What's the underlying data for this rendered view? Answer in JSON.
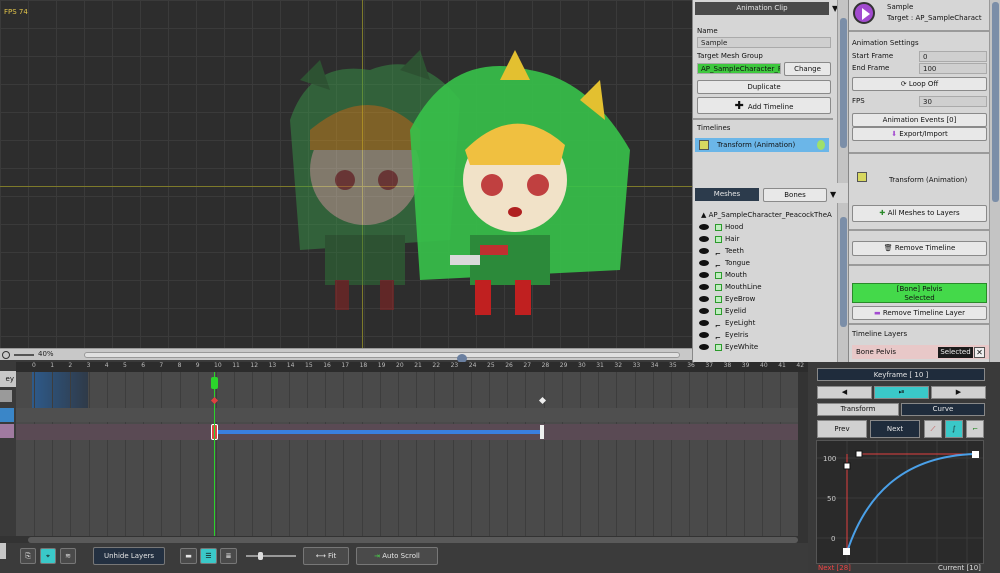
{
  "viewport": {
    "fps_label": "FPS 74",
    "zoom_label": "40%"
  },
  "anim_clip": {
    "header": "Animation Clip",
    "name_label": "Name",
    "name_value": "Sample",
    "target_mesh_group_label": "Target Mesh Group",
    "target_mesh_group_value": "AP_SampleCharacter_F",
    "change_button": "Change",
    "duplicate_button": "Duplicate",
    "add_timeline_button": "Add Timeline",
    "timelines_label": "Timelines",
    "timeline_item": "Transform (Animation)"
  },
  "mesh_list": {
    "tab_meshes": "Meshes",
    "tab_bones": "Bones",
    "root_label": "AP_SampleCharacter_PeacockTheA",
    "items": [
      "Hood",
      "Hair",
      "Teeth",
      "Tongue",
      "Mouth",
      "MouthLine",
      "EyeBrow",
      "Eyelid",
      "EyeLight",
      "EyeIris",
      "EyeWhite"
    ],
    "item_types": [
      "mesh",
      "mesh",
      "bone",
      "bone",
      "mesh",
      "mesh",
      "mesh",
      "mesh",
      "bone",
      "bone",
      "mesh"
    ]
  },
  "clip_info": {
    "title": "Sample",
    "target": "Target : AP_SampleCharact",
    "settings_label": "Animation Settings",
    "start_frame_label": "Start Frame",
    "start_frame_value": "0",
    "end_frame_label": "End Frame",
    "end_frame_value": "100",
    "loop_button": "Loop Off",
    "fps_label": "FPS",
    "fps_value": "30",
    "events_button": "Animation Events [0]",
    "export_button": "Export/Import",
    "timeline_name": "Transform (Animation)",
    "all_meshes_button": "All Meshes to Layers",
    "remove_timeline_button": "Remove Timeline",
    "selected_layer_title": "[Bone] Pelvis",
    "selected_layer_sub": "Selected",
    "remove_timeline_layer_button": "Remove Timeline Layer",
    "timeline_layers_label": "Timeline Layers",
    "layer_item": "Bone Pelvis",
    "layer_selected_badge": "Selected"
  },
  "timeline": {
    "ticks": [
      "0",
      "1",
      "2",
      "3",
      "4",
      "5",
      "6",
      "7",
      "8",
      "9",
      "10",
      "11",
      "12",
      "13",
      "14",
      "15",
      "16",
      "17",
      "18",
      "19",
      "20",
      "21",
      "22",
      "23",
      "24",
      "25",
      "26",
      "27",
      "28",
      "29",
      "30",
      "31",
      "32",
      "33",
      "34",
      "35",
      "36",
      "37",
      "38",
      "39",
      "40",
      "41",
      "42"
    ],
    "left_label": "ey",
    "current_frame": 10,
    "next_key_frame": 28
  },
  "bottom_bar": {
    "unhide_layers_button": "Unhide Layers",
    "fit_button": "Fit",
    "auto_scroll_button": "Auto Scroll"
  },
  "keyframe": {
    "header": "Keyframe [ 10 ]",
    "tab_transform": "Transform",
    "tab_curve": "Curve",
    "prev_button": "Prev",
    "next_button": "Next",
    "y_labels": [
      "100",
      "50",
      "0"
    ],
    "footer_left": "Next [28]",
    "footer_right": "Current [10]"
  }
}
